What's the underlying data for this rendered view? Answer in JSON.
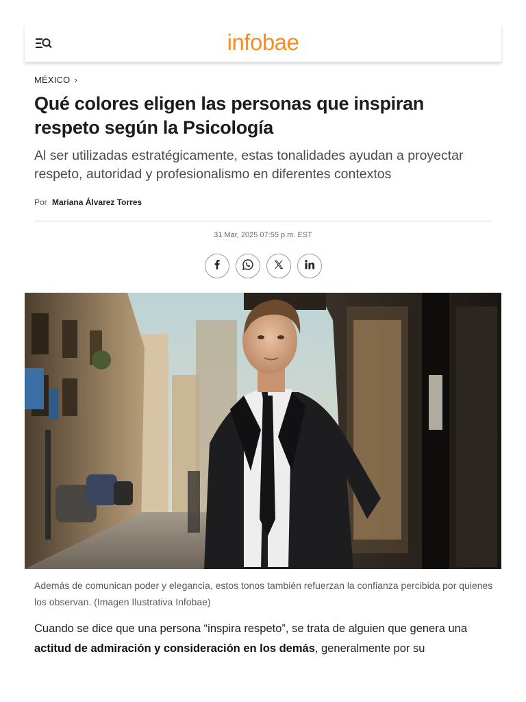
{
  "header": {
    "logo": "infobae",
    "menu_icon": "menu-search-icon",
    "brand_color": "#f68d1e"
  },
  "article": {
    "section": "MÉXICO",
    "title": "Qué colores eligen las personas que inspiran respeto según la Psicología",
    "subtitle": "Al ser utilizadas estratégicamente, estas tonalidades ayudan a proyectar respeto, autoridad y profesionalismo en diferentes contextos",
    "byline_prefix": "Por",
    "author": "Mariana Álvarez Torres",
    "date": "31 Mar, 2025 07:55 p.m. EST",
    "share": [
      {
        "network": "Facebook",
        "icon": "facebook-icon"
      },
      {
        "network": "WhatsApp",
        "icon": "whatsapp-icon"
      },
      {
        "network": "X",
        "icon": "x-icon"
      },
      {
        "network": "LinkedIn",
        "icon": "linkedin-icon"
      }
    ],
    "image_caption": "Además de comunican poder y elegancia, estos tonos también refuerzan la confianza percibida por quienes los observan. (Imagen Ilustrativa Infobae)",
    "body_intro": "Cuando se dice que una persona “inspira respeto”, se trata de alguien que genera una ",
    "body_bold": "actitud de admiración y consideración en los demás",
    "body_rest": ", generalmente por su"
  }
}
